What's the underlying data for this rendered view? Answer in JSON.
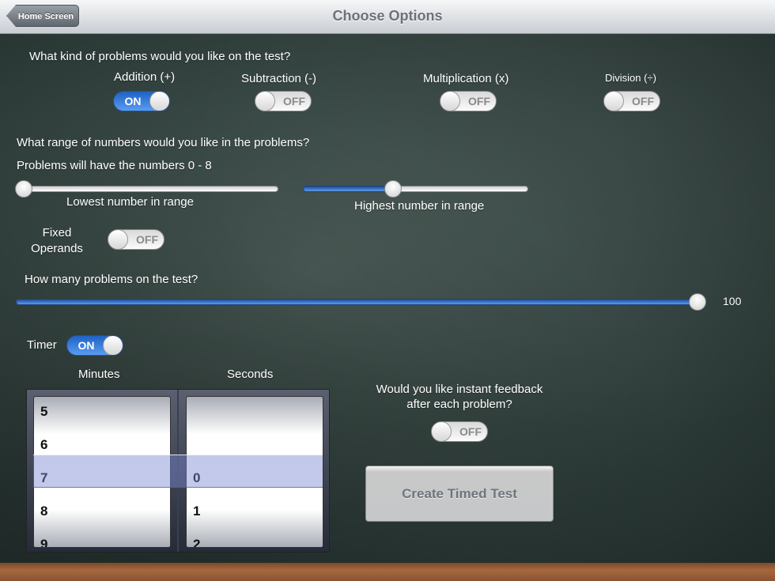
{
  "header": {
    "title": "Choose Options",
    "back_label": "Home Screen"
  },
  "problem_types": {
    "question": "What kind of problems would you like on the test?",
    "addition": {
      "label": "Addition (+)",
      "state": "ON"
    },
    "subtraction": {
      "label": "Subtraction (-)",
      "state": "OFF"
    },
    "multiplication": {
      "label": "Multiplication (x)",
      "state": "OFF"
    },
    "division": {
      "label": "Division (÷)",
      "state": "OFF"
    }
  },
  "range": {
    "question": "What range of numbers would you like in the problems?",
    "summary": "Problems will have the numbers 0 - 8",
    "lowest_label": "Lowest number in range",
    "highest_label": "Highest number in range",
    "lowest_fraction": 0.0,
    "highest_fraction": 0.4
  },
  "fixed_operands": {
    "label_line1": "Fixed",
    "label_line2": "Operands",
    "state": "OFF"
  },
  "problem_count": {
    "question": "How many problems on the test?",
    "value": "100",
    "fraction": 1.0
  },
  "timer": {
    "label": "Timer",
    "state": "ON"
  },
  "time_picker": {
    "minutes_label": "Minutes",
    "seconds_label": "Seconds",
    "minutes_items": [
      "5",
      "6",
      "7",
      "8",
      "9"
    ],
    "seconds_items": [
      "",
      "",
      "0",
      "1",
      "2"
    ],
    "selected_minutes": "7",
    "selected_seconds": "0"
  },
  "feedback": {
    "question_line1": "Would you like instant feedback",
    "question_line2": "after each problem?",
    "state": "OFF"
  },
  "create_button": {
    "label": "Create Timed Test"
  }
}
